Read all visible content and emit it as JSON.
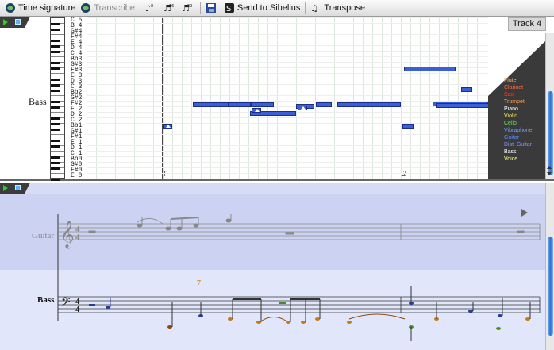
{
  "toolbar": {
    "time_signature": "Time signature",
    "transcribe": "Transcribe",
    "send_to_sibelius": "Send to Sibelius",
    "transpose": "Transpose"
  },
  "piano_roll": {
    "track_name": "Bass",
    "track_tab": "Track 4",
    "note_names": [
      "C 5",
      "B 4",
      "G#4",
      "F#4",
      "E 4",
      "D 4",
      "C 4",
      "Bb3",
      "G#3",
      "F#3",
      "E 3",
      "D 3",
      "C 3",
      "Bb2",
      "G#2",
      "F#2",
      "E 2",
      "D 2",
      "C 2",
      "Bb1",
      "G#1",
      "F#1",
      "E 1",
      "D 1",
      "C 1",
      "Bb0",
      "G#0",
      "F#0",
      "E 0"
    ],
    "bar_numbers": [
      "1",
      "2"
    ],
    "instruments": [
      {
        "name": "Flute",
        "color": "#f0b070"
      },
      {
        "name": "Clarinet",
        "color": "#ff6a4a"
      },
      {
        "name": "Sax",
        "color": "#ff3a2a"
      },
      {
        "name": "Trumpet",
        "color": "#ff9a3a"
      },
      {
        "name": "Piano",
        "color": "#ffffff"
      },
      {
        "name": "Violin",
        "color": "#e8e860"
      },
      {
        "name": "Cello",
        "color": "#60e060"
      },
      {
        "name": "Vibraphone",
        "color": "#6aa0ff"
      },
      {
        "name": "Guitar",
        "color": "#5a8aff"
      },
      {
        "name": "Dist. Guitar",
        "color": "#8a8aff"
      },
      {
        "name": "Bass",
        "color": "#ffffff"
      },
      {
        "name": "Voice",
        "color": "#ffff80"
      }
    ]
  },
  "score": {
    "staves": [
      {
        "name": "Guitar"
      },
      {
        "name": "Bass"
      }
    ],
    "time_signature": {
      "top": "4",
      "bottom": "4"
    }
  },
  "colors": {
    "note_fill": "#3a5fd6",
    "score_bg": "#d6dcf6"
  }
}
